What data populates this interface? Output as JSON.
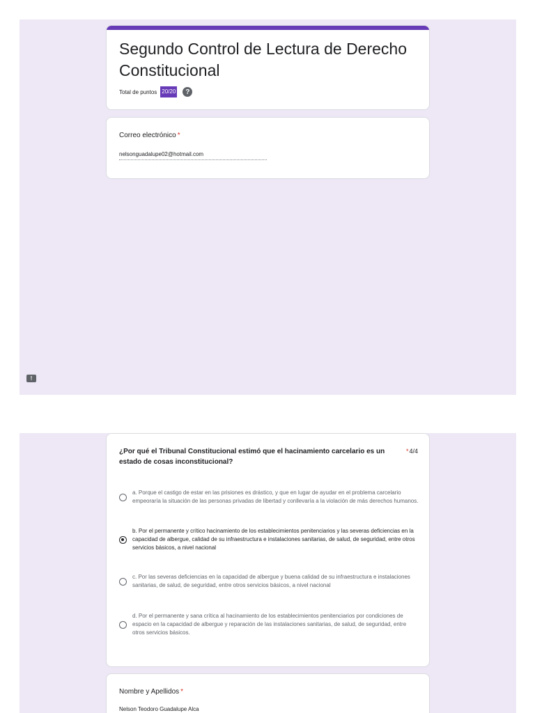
{
  "form": {
    "title": "Segundo Control de Lectura de Derecho Constitucional",
    "points_label": "Total de puntos",
    "points_value": "20/20",
    "help_glyph": "?"
  },
  "email_field": {
    "label": "Correo electrónico",
    "required_mark": "*",
    "value": "nelsonguadalupe02@hotmail.com"
  },
  "feedback": {
    "glyph": "!",
    "icon": "feedback-icon"
  },
  "question": {
    "text": "¿Por qué el Tribunal Constitucional estimó que el hacinamiento carcelario es un estado de cosas inconstitucional?",
    "required_mark": "*",
    "score": "4/4",
    "options": [
      {
        "label": "a. Porque el castigo de estar en las prisiones es drástico, y que en lugar de ayudar en el problema carcelario empeoraría la situación de las personas privadas de libertad y conllevaría a la violación de más derechos humanos.",
        "selected": false
      },
      {
        "label": "b. Por el permanente y crítico hacinamiento de los establecimientos penitenciarios y las severas deficiencias en la capacidad de albergue, calidad de su infraestructura e instalaciones sanitarias, de salud, de seguridad, entre otros servicios básicos, a nivel nacional",
        "selected": true
      },
      {
        "label": "c. Por las severas deficiencias en la capacidad de albergue y buena calidad de su infraestructura e instalaciones sanitarias, de salud, de seguridad, entre otros servicios básicos, a nivel nacional",
        "selected": false
      },
      {
        "label": "d. Por el permanente y sana crítica al hacinamiento de los establecimientos penitenciarios por condiciones de espacio en la capacidad de albergue y reparación de las instalaciones sanitarias, de salud, de seguridad, entre otros servicios básicos.",
        "selected": false
      }
    ]
  },
  "name_field": {
    "label": "Nombre y Apellidos",
    "required_mark": "*",
    "value": "Nelson Teodoro Guadalupe Alca"
  },
  "colors": {
    "accent": "#673ab7",
    "background": "#ede7f6",
    "required": "#d93025"
  }
}
